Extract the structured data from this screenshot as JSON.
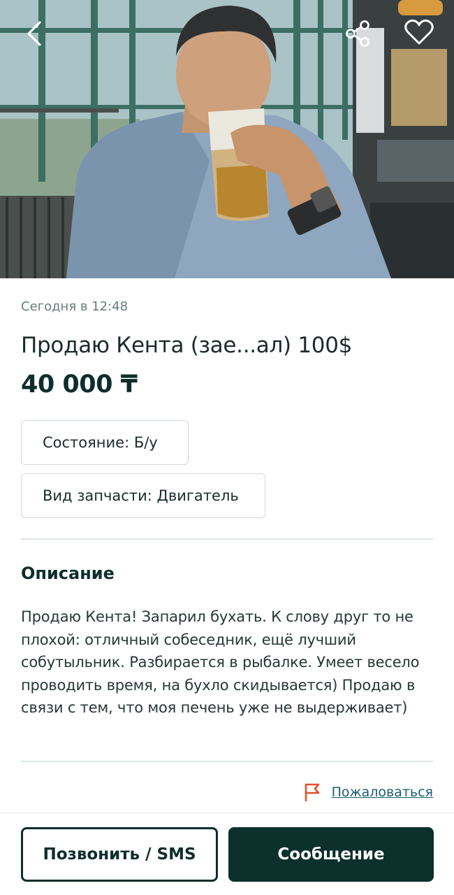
{
  "listing": {
    "posted": "Сегодня в 12:48",
    "title": "Продаю Кента (зае...ал) 100$",
    "price": "40 000 ₸",
    "attributes": [
      {
        "label": "Состояние: Б/у"
      },
      {
        "label": "Вид запчасти: Двигатель"
      }
    ],
    "description_heading": "Описание",
    "description": "Продаю Кента! Запарил бухать. К слову друг то не плохой: отличный собеседник, ещё лучший собутыльник. Разбирается в рыбалке. Умеет весело проводить время, на бухло скидывается) Продаю в связи с тем, что моя печень уже не выдерживает)",
    "report_label": "Пожаловаться"
  },
  "photo_toolbar": {
    "icons": [
      "chevron-left-icon",
      "share-icon",
      "heart-icon"
    ]
  },
  "actions": {
    "call_label": "Позвонить / SMS",
    "message_label": "Сообщение"
  },
  "colors": {
    "brand_dark": "#0c302c",
    "link": "#1c5e6e",
    "report_flag": "#e0532d"
  }
}
